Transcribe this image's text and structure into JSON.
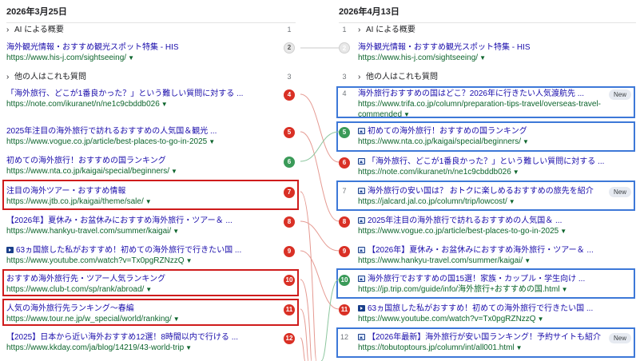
{
  "left": {
    "date": "2026年3月25日",
    "ai_overview": {
      "label": "AI による概要",
      "num": "1"
    },
    "items": [
      {
        "num": "2",
        "title": "海外観光情報・おすすめ観光スポット特集 - HIS",
        "url": "https://www.his-j.com/sightseeing/"
      },
      {
        "num": "3",
        "feature": "他の人はこれも質問"
      },
      {
        "num": "4",
        "title": "「海外旅行、どこが1番良かった？」という難しい質問に対する ...",
        "url": "https://note.com/ikuranet/n/ne1c9cbddb026"
      },
      {
        "num": "5",
        "title": "2025年注目の海外旅行で訪れるおすすめの人気国＆観光 ...",
        "url": "https://www.vogue.co.jp/article/best-places-to-go-in-2025"
      },
      {
        "num": "6",
        "title": "初めての海外旅行！おすすめの国ランキング",
        "url": "https://www.nta.co.jp/kaigai/special/beginners/"
      },
      {
        "num": "7",
        "title": "注目の海外ツアー・おすすめ情報",
        "url": "https://www.jtb.co.jp/kaigai/theme/sale/"
      },
      {
        "num": "8",
        "title": "【2026年】夏休み・お盆休みにおすすめ海外旅行・ツアー＆ ...",
        "url": "https://www.hankyu-travel.com/summer/kaigai/"
      },
      {
        "num": "9",
        "title": "63ヵ国旅した私がおすすめ！初めての海外旅行で行きたい国 ...",
        "url": "https://www.youtube.com/watch?v=Tx0pgRZNzzQ"
      },
      {
        "num": "10",
        "title": "おすすめ海外旅行先・ツアー人気ランキング",
        "url": "https://www.club-t.com/sp/rank/abroad/"
      },
      {
        "num": "11",
        "title": "人気の海外旅行先ランキング〜春編",
        "url": "https://www.tour.ne.jp/w_special/world/ranking/"
      },
      {
        "num": "12",
        "title": "【2025】日本から近い海外おすすめ12選！8時間以内で行ける ...",
        "url": "https://www.kkday.com/ja/blog/14219/43-world-trip"
      }
    ]
  },
  "right": {
    "date": "2026年4月13日",
    "ai_overview": {
      "label": "AI による概要",
      "num": "1"
    },
    "items": [
      {
        "num": "2",
        "title": "海外観光情報・おすすめ観光スポット特集 - HIS",
        "url": "https://www.his-j.com/sightseeing/"
      },
      {
        "num": "3",
        "feature": "他の人はこれも質問"
      },
      {
        "num": "4",
        "title": "海外旅行おすすめの国はどこ？2026年に行きたい人気渡航先 ...",
        "url": "https://www.trifa.co.jp/column/preparation-tips-travel/overseas-travel-re",
        "url2": "commended",
        "badge": "New"
      },
      {
        "num": "5",
        "title": "初めての海外旅行！おすすめの国ランキング",
        "url": "https://www.nta.co.jp/kaigai/special/beginners/"
      },
      {
        "num": "6",
        "title": "「海外旅行、どこが1番良かった？」という難しい質問に対する ...",
        "url": "https://note.com/ikuranet/n/ne1c9cbddb026"
      },
      {
        "num": "7",
        "title": "海外旅行の安い国は？ おトクに楽しめるおすすめの旅先を紹介",
        "url": "https://jalcard.jal.co.jp/column/trip/lowcost/",
        "badge": "New"
      },
      {
        "num": "8",
        "title": "2025年注目の海外旅行で訪れるおすすめの人気国＆ ...",
        "url": "https://www.vogue.co.jp/article/best-places-to-go-in-2025"
      },
      {
        "num": "9",
        "title": "【2026年】夏休み・お盆休みにおすすめ海外旅行・ツアー＆ ...",
        "url": "https://www.hankyu-travel.com/summer/kaigai/"
      },
      {
        "num": "10",
        "title": "海外旅行でおすすめの国15選！家族・カップル・学生向け ...",
        "url": "https://jp.trip.com/guide/info/海外旅行+おすすめの国.html"
      },
      {
        "num": "11",
        "title": "63ヵ国旅した私がおすすめ！初めての海外旅行で行きたい国 ...",
        "url": "https://www.youtube.com/watch?v=Tx0pgRZNzzQ"
      },
      {
        "num": "12",
        "title": "【2026年最新】海外旅行が安い国ランキング！予約サイトも紹介",
        "url": "https://tobutoptours.jp/column/int/all001.html",
        "badge": "New"
      }
    ]
  },
  "colors": {
    "red": "#d93025",
    "green": "#3a9a58",
    "blue_box": "#3d78d8",
    "red_box": "#cf1b1b"
  }
}
